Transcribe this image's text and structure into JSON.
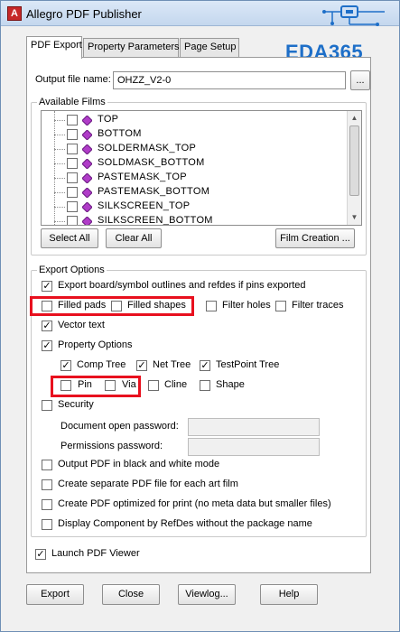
{
  "window": {
    "title": "Allegro PDF Publisher"
  },
  "brand": {
    "text": "EDA365"
  },
  "tabs": [
    {
      "label": "PDF Export",
      "active": true
    },
    {
      "label": "Property Parameters",
      "active": false
    },
    {
      "label": "Page Setup",
      "active": false
    }
  ],
  "output": {
    "label": "Output file name:",
    "value": "OHZZ_V2-0",
    "browse_label": "..."
  },
  "films": {
    "group_title": "Available Films",
    "items": [
      {
        "name": "TOP",
        "checked": false
      },
      {
        "name": "BOTTOM",
        "checked": false
      },
      {
        "name": "SOLDERMASK_TOP",
        "checked": false
      },
      {
        "name": "SOLDMASK_BOTTOM",
        "checked": false
      },
      {
        "name": "PASTEMASK_TOP",
        "checked": false
      },
      {
        "name": "PASTEMASK_BOTTOM",
        "checked": false
      },
      {
        "name": "SILKSCREEN_TOP",
        "checked": false
      },
      {
        "name": "SILKSCREEN_BOTTOM",
        "checked": false
      }
    ],
    "select_all_label": "Select All",
    "clear_all_label": "Clear All",
    "film_creation_label": "Film Creation ..."
  },
  "export_options": {
    "group_title": "Export Options",
    "export_outlines": {
      "label": "Export board/symbol outlines and refdes if pins exported",
      "checked": true
    },
    "filled_pads": {
      "label": "Filled pads",
      "checked": false
    },
    "filled_shapes": {
      "label": "Filled shapes",
      "checked": false
    },
    "filter_holes": {
      "label": "Filter holes",
      "checked": false
    },
    "filter_traces": {
      "label": "Filter traces",
      "checked": false
    },
    "vector_text": {
      "label": "Vector text",
      "checked": true
    },
    "property_options": {
      "label": "Property Options",
      "checked": true
    },
    "comp_tree": {
      "label": "Comp Tree",
      "checked": true
    },
    "net_tree": {
      "label": "Net Tree",
      "checked": true
    },
    "testpoint_tree": {
      "label": "TestPoint Tree",
      "checked": true
    },
    "pin": {
      "label": "Pin",
      "checked": false
    },
    "via": {
      "label": "Via",
      "checked": false
    },
    "cline": {
      "label": "Cline",
      "checked": false
    },
    "shape": {
      "label": "Shape",
      "checked": false
    },
    "security": {
      "label": "Security",
      "checked": false
    },
    "doc_open_password_label": "Document open password:",
    "permissions_password_label": "Permissions password:",
    "black_white": {
      "label": "Output PDF in black and white mode",
      "checked": false
    },
    "separate_pdf": {
      "label": "Create separate PDF file for each art film",
      "checked": false
    },
    "optimized_print": {
      "label": "Create PDF optimized for print (no meta data but smaller files)",
      "checked": false
    },
    "display_refdes": {
      "label": "Display Component by RefDes without the package name",
      "checked": false
    }
  },
  "launch_viewer": {
    "label": "Launch PDF Viewer",
    "checked": true
  },
  "buttons": {
    "export": "Export",
    "close": "Close",
    "viewlog": "Viewlog...",
    "help": "Help"
  },
  "colors": {
    "highlight_box": "#e8101e",
    "brand": "#1e6fc8",
    "film_icon": "#b03cc8"
  },
  "icons": {
    "film": "diamond-icon",
    "app": "pdf-publisher-icon",
    "logo": "circuit-chip-icon"
  }
}
